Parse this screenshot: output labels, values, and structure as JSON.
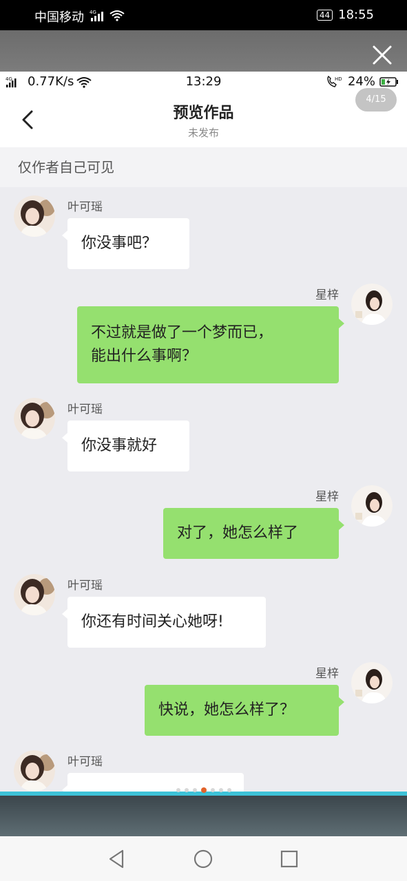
{
  "outer_status": {
    "carrier": "中国移动",
    "network": "4G",
    "battery": "44",
    "time": "18:55"
  },
  "inner_status": {
    "network": "4G",
    "speed": "0.77K/s",
    "time": "13:29",
    "hd": "HD",
    "battery": "24%"
  },
  "counter": "4/15",
  "header": {
    "title": "预览作品",
    "subtitle": "未发布"
  },
  "privacy_note": "仅作者自己可见",
  "messages": [
    {
      "side": "left",
      "name": "叶可瑶",
      "text": "你没事吧？"
    },
    {
      "side": "right",
      "name": "星梓",
      "line1": "不过就是做了一个梦而已，",
      "line2": "能出什么事啊？"
    },
    {
      "side": "left",
      "name": "叶可瑶",
      "text": "你没事就好"
    },
    {
      "side": "right",
      "name": "星梓",
      "text": "对了，她怎么样了"
    },
    {
      "side": "left",
      "name": "叶可瑶",
      "text": "你还有时间关心她呀!"
    },
    {
      "side": "right",
      "name": "星梓",
      "text": "快说，她怎么样了？"
    },
    {
      "side": "left",
      "name": "叶可瑶",
      "text": ""
    }
  ],
  "pager": {
    "total": 7,
    "active": 3
  },
  "colors": {
    "accent_green": "#95e06f",
    "strip": "#3dc2d8",
    "active_dot": "#e2632a"
  },
  "icons": [
    "close-icon",
    "back-chevron-icon",
    "wifi-icon",
    "signal-icon",
    "battery-icon",
    "nav-back-icon",
    "nav-home-icon",
    "nav-recents-icon"
  ]
}
